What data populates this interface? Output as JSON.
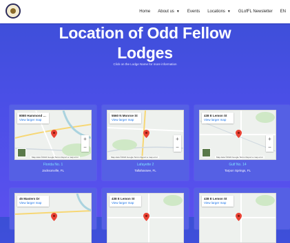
{
  "nav": {
    "items": [
      "Home",
      "About us",
      "Events",
      "Locations",
      "GLofFL Newsletter",
      "EN"
    ]
  },
  "hero": {
    "title_line1": "Location of Odd Fellow",
    "title_line2": "Lodges",
    "subtitle": "Click on the Lodge Name for more information"
  },
  "map_ui": {
    "view_larger": "View larger map",
    "attribution": "Map data ©2024 Google  Terms  Report a map error",
    "zoom_in": "+",
    "zoom_out": "−"
  },
  "cards": [
    {
      "address": "8080 Hammond Bl...",
      "name": "Florida No. 1",
      "location": "Jacksonville, FL"
    },
    {
      "address": "5560 N Monroe St",
      "name": "Lafayette 2",
      "location": "Tallahassee, FL"
    },
    {
      "address": "438 E Lemon St",
      "name": "Gulf No. 14",
      "location": "Tarpon Springs, FL"
    },
    {
      "address": "45 Masters Dr",
      "name": "",
      "location": ""
    },
    {
      "address": "438 E Lemon St",
      "name": "",
      "location": ""
    },
    {
      "address": "438 E Lemon St",
      "name": "",
      "location": ""
    }
  ],
  "colors": {
    "accent_text": "#7ee0ff",
    "background": "#4a4fe6",
    "pin": "#ea4335"
  }
}
